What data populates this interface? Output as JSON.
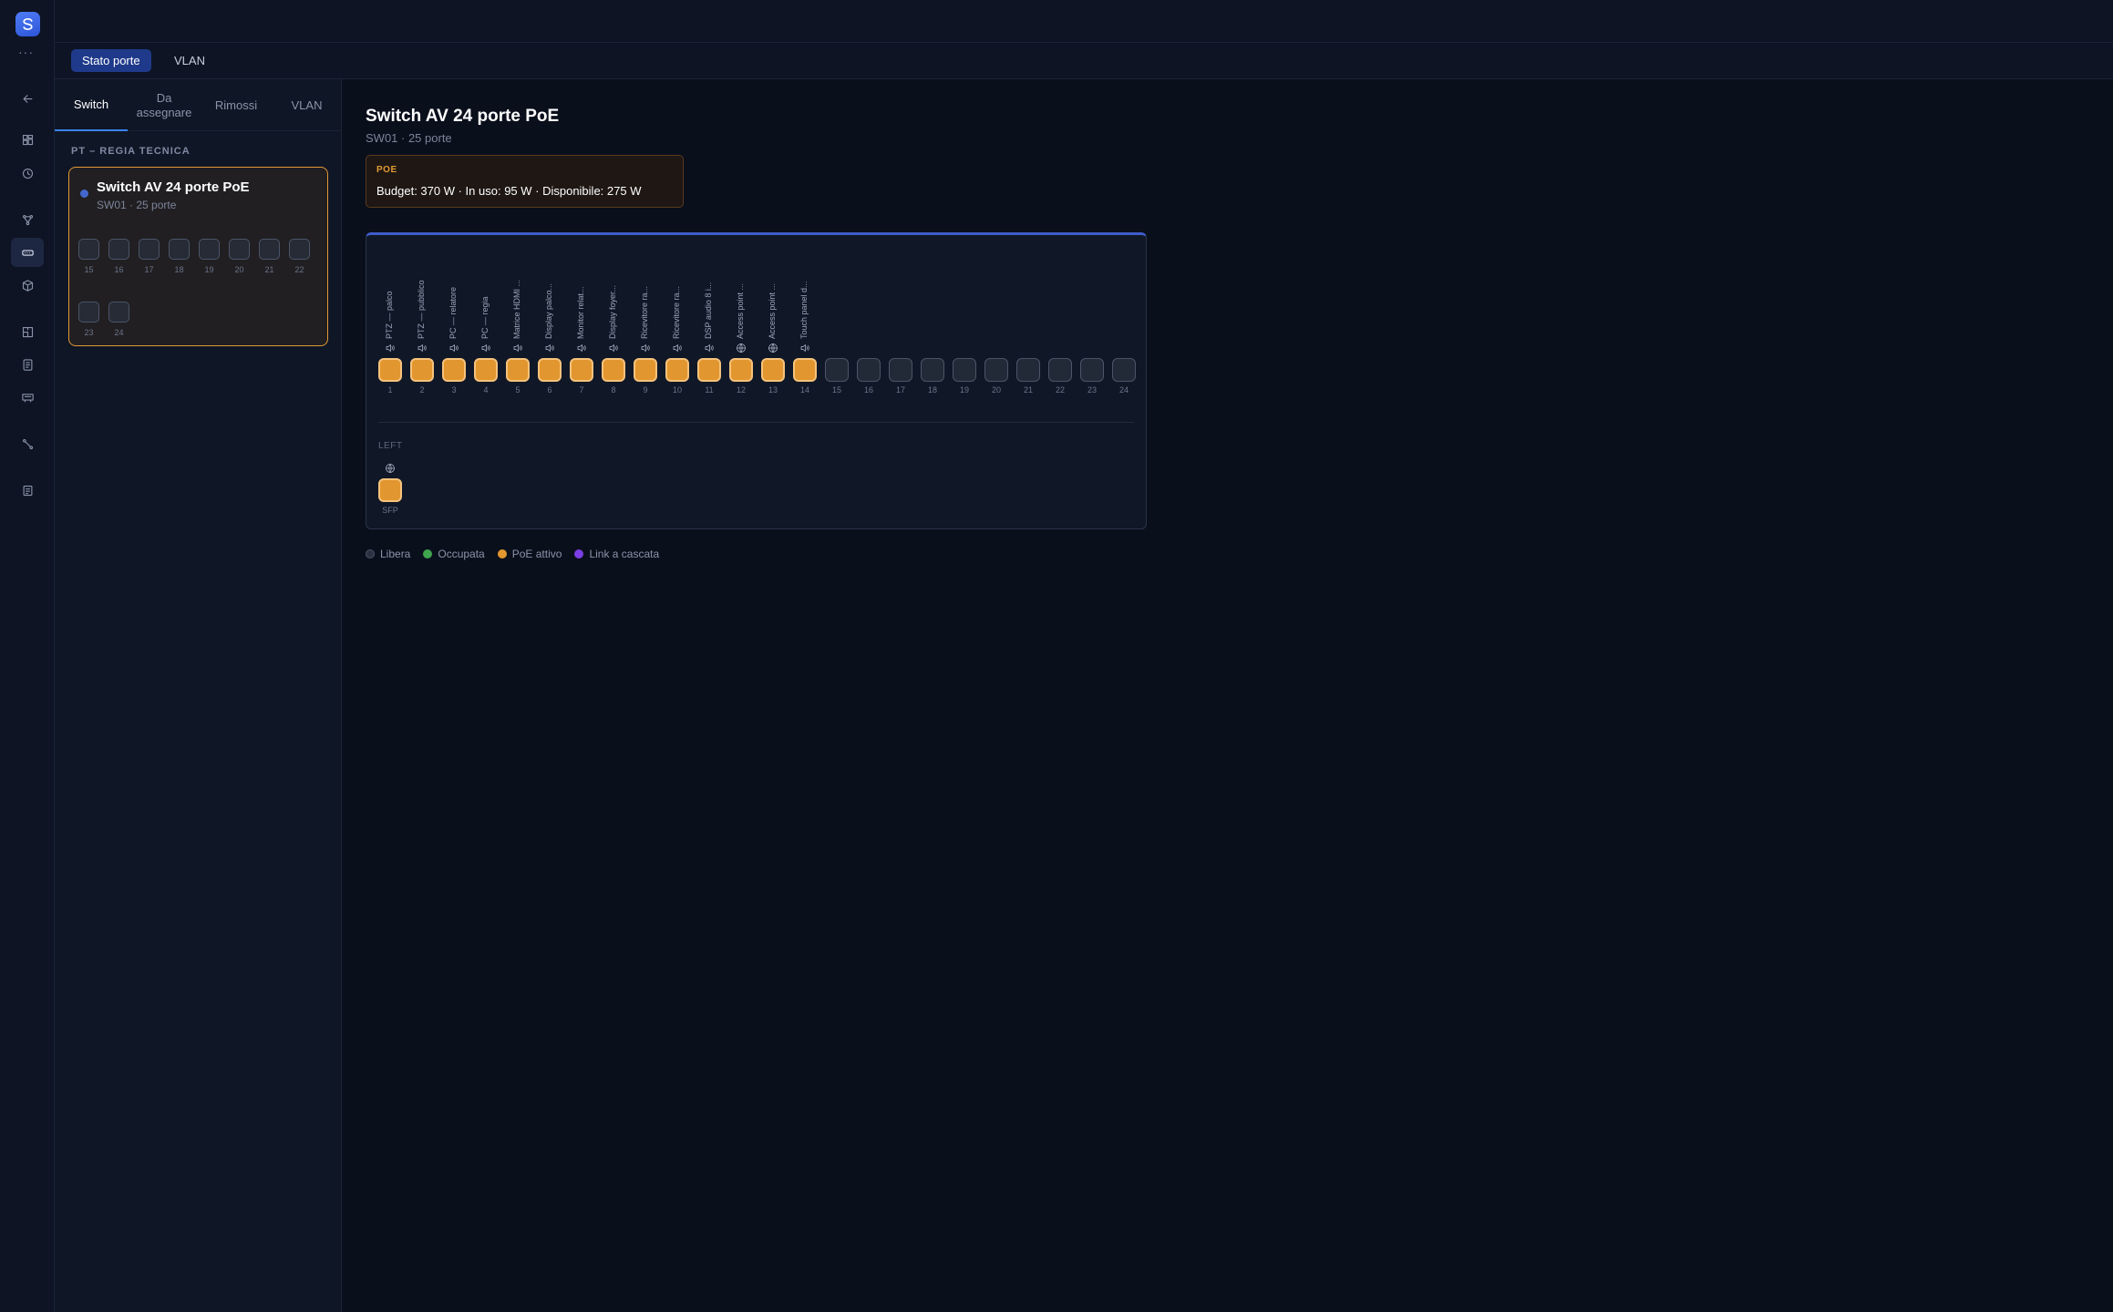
{
  "top_tabs": [
    {
      "label": "Stato porte",
      "active": true
    },
    {
      "label": "VLAN",
      "active": false
    }
  ],
  "sidebar": {
    "tabs": [
      {
        "label": "Switch",
        "active": true
      },
      {
        "label": "Da assegnare",
        "active": false
      },
      {
        "label": "Rimossi",
        "active": false
      },
      {
        "label": "VLAN",
        "active": false
      }
    ],
    "group_label": "PT – REGIA TECNICA",
    "switch_card": {
      "name": "Switch AV 24 porte PoE",
      "subtitle": "SW01 · 25 porte",
      "ports": [
        "15",
        "16",
        "17",
        "18",
        "19",
        "20",
        "21",
        "22",
        "23",
        "24"
      ]
    }
  },
  "main": {
    "title": "Switch AV 24 porte PoE",
    "subtitle": "SW01 · 25 porte",
    "poe": {
      "label": "POE",
      "text": "Budget: 370 W · In uso: 95 W · Disponibile: 275 W"
    },
    "ports": [
      {
        "num": "1",
        "label": "PTZ — palco",
        "icon": "speaker-icon",
        "poe": true
      },
      {
        "num": "2",
        "label": "PTZ — pubblico",
        "icon": "speaker-icon",
        "poe": true
      },
      {
        "num": "3",
        "label": "PC — relatore",
        "icon": "speaker-icon",
        "poe": true
      },
      {
        "num": "4",
        "label": "PC — regia",
        "icon": "speaker-icon",
        "poe": true
      },
      {
        "num": "5",
        "label": "Matrice HDMI ...",
        "icon": "speaker-icon",
        "poe": true
      },
      {
        "num": "6",
        "label": "Display palco...",
        "icon": "speaker-icon",
        "poe": true
      },
      {
        "num": "7",
        "label": "Monitor relat...",
        "icon": "speaker-icon",
        "poe": true
      },
      {
        "num": "8",
        "label": "Display foyer...",
        "icon": "speaker-icon",
        "poe": true
      },
      {
        "num": "9",
        "label": "Ricevitore ra...",
        "icon": "speaker-icon",
        "poe": true
      },
      {
        "num": "10",
        "label": "Ricevitore ra...",
        "icon": "speaker-icon",
        "poe": true
      },
      {
        "num": "11",
        "label": "DSP audio 8 i...",
        "icon": "speaker-icon",
        "poe": true
      },
      {
        "num": "12",
        "label": "Access point ...",
        "icon": "globe-icon",
        "poe": true
      },
      {
        "num": "13",
        "label": "Access point ...",
        "icon": "globe-icon",
        "poe": true
      },
      {
        "num": "14",
        "label": "Touch panel d...",
        "icon": "speaker-icon",
        "poe": true
      },
      {
        "num": "15",
        "label": "",
        "icon": "",
        "poe": false
      },
      {
        "num": "16",
        "label": "",
        "icon": "",
        "poe": false
      },
      {
        "num": "17",
        "label": "",
        "icon": "",
        "poe": false
      },
      {
        "num": "18",
        "label": "",
        "icon": "",
        "poe": false
      },
      {
        "num": "19",
        "label": "",
        "icon": "",
        "poe": false
      },
      {
        "num": "20",
        "label": "",
        "icon": "",
        "poe": false
      },
      {
        "num": "21",
        "label": "",
        "icon": "",
        "poe": false
      },
      {
        "num": "22",
        "label": "",
        "icon": "",
        "poe": false
      },
      {
        "num": "23",
        "label": "",
        "icon": "",
        "poe": false
      },
      {
        "num": "24",
        "label": "",
        "icon": "",
        "poe": false
      }
    ],
    "left_section": {
      "label": "LEFT",
      "port": {
        "num": "SFP",
        "icon": "globe-icon",
        "poe": true
      }
    },
    "legend": [
      {
        "label": "Libera",
        "color": "#2b3140"
      },
      {
        "label": "Occupata",
        "color": "#3fa34d"
      },
      {
        "label": "PoE attivo",
        "color": "#e2962f"
      },
      {
        "label": "Link a cascata",
        "color": "#7b3fe4"
      }
    ]
  }
}
